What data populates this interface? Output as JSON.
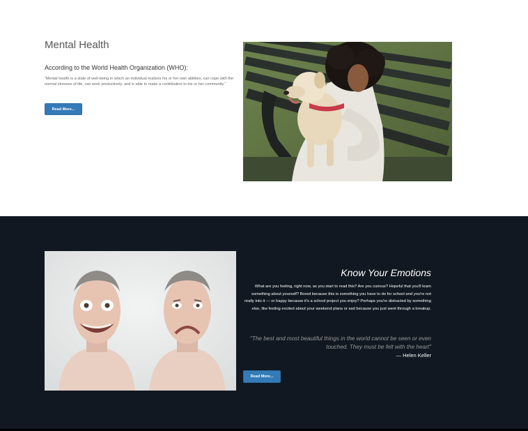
{
  "mental_health": {
    "title": "Mental Health",
    "subtitle": "According to the World Health Organization (WHO):",
    "body": "“Mental health is a state of well-being in which an individual realizes his or her own abilities, can cope with the normal stresses of life, can work productively, and is able to make a contribution to his or her community.”",
    "button_label": "Read More...",
    "image_alt": "woman-hugging-dog-on-bench"
  },
  "emotions": {
    "title": "Know Your Emotions",
    "body": "What are you feeling, right now, as you start to read this? Are you curious? Hopeful that you'll learn something about yourself? Bored because this is something you have to do for school and you're not really into it — or happy because it's a school project you enjoy? Perhaps you're distracted by something else, like feeling excited about your weekend plans or sad because you just went through a breakup.",
    "quote": "\"The best and most beautiful things in the world cannot be seen or even touched. They must be felt with the heart\"",
    "author": "— Helen Keller",
    "button_label": "Read More...",
    "image_alt": "two-faces-smiling-and-frowning"
  },
  "colors": {
    "accent": "#337ab7",
    "dark_section": "#111821"
  }
}
